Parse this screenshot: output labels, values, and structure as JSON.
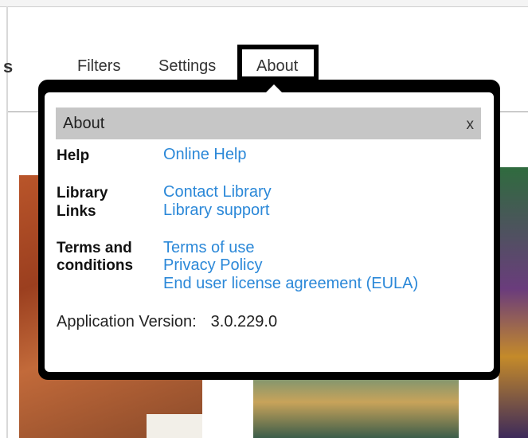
{
  "nav": {
    "cut_label": "s",
    "tabs": [
      {
        "label": "Filters"
      },
      {
        "label": "Settings"
      },
      {
        "label": "About"
      }
    ]
  },
  "dialog": {
    "title": "About",
    "close": "x",
    "help": {
      "label": "Help",
      "links": [
        "Online Help"
      ]
    },
    "library": {
      "label_line1": "Library",
      "label_line2": "Links",
      "links": [
        "Contact Library",
        "Library support"
      ]
    },
    "terms": {
      "label_line1": "Terms and",
      "label_line2": "conditions",
      "links": [
        "Terms of use",
        "Privacy Policy",
        "End user license agreement (EULA)"
      ]
    },
    "version": {
      "label": "Application Version:",
      "value": "3.0.229.0"
    }
  },
  "colors": {
    "link": "#2b88d8",
    "header_bg": "#c6c6c6",
    "highlight_outline": "#000000"
  }
}
